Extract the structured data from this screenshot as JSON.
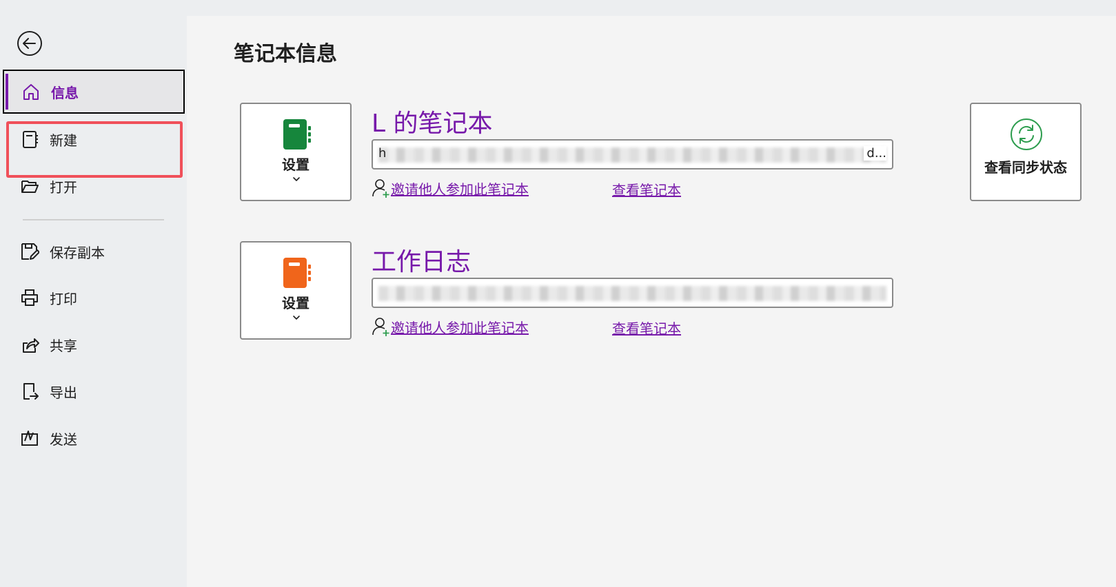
{
  "sidebar": {
    "back_label": "",
    "items": [
      {
        "label": "信息",
        "icon": "home-icon",
        "active": true
      },
      {
        "label": "新建",
        "icon": "new-notebook-icon"
      },
      {
        "label": "打开",
        "icon": "folder-open-icon"
      },
      {
        "label": "保存副本",
        "icon": "save-copy-icon"
      },
      {
        "label": "打印",
        "icon": "printer-icon"
      },
      {
        "label": "共享",
        "icon": "share-icon"
      },
      {
        "label": "导出",
        "icon": "export-icon"
      },
      {
        "label": "发送",
        "icon": "send-icon"
      }
    ]
  },
  "main": {
    "title": "笔记本信息",
    "notebooks": [
      {
        "name": "L 的笔记本",
        "settings_label": "设置",
        "icon_color": "#16863c",
        "url_start": "h",
        "url_end": "d...",
        "invite_label": "邀请他人参加此笔记本",
        "view_label": "查看笔记本"
      },
      {
        "name": "工作日志",
        "settings_label": "设置",
        "icon_color": "#f0651b",
        "url_start": "",
        "url_end": "",
        "invite_label": "邀请他人参加此笔记本",
        "view_label": "查看笔记本"
      }
    ],
    "sync": {
      "label": "查看同步状态",
      "icon": "sync-icon",
      "icon_color": "#2e9d4f"
    }
  },
  "colors": {
    "accent": "#7719aa",
    "highlight": "#f0505a"
  }
}
